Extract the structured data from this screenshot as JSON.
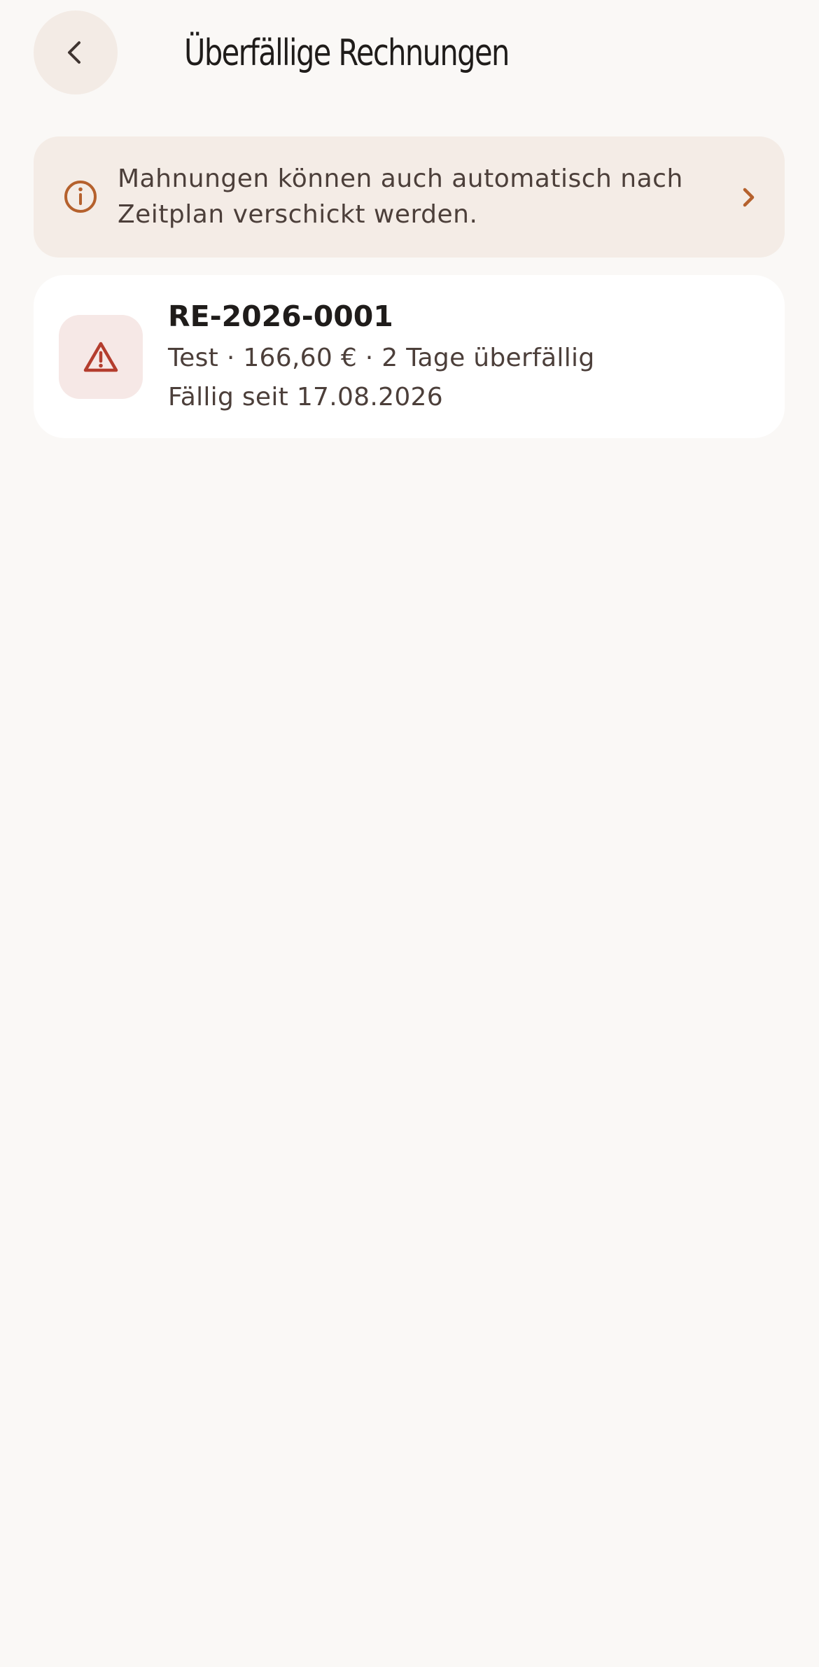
{
  "header": {
    "title": "Überfällige Rechnungen",
    "back_icon": "chevron-left-icon"
  },
  "info_banner": {
    "text_line1": "Mahnungen können auch automatisch nach",
    "text_line2": "Zeitplan verschickt werden.",
    "icon": "info-icon",
    "action_icon": "chevron-right-icon",
    "accent_color": "#b5612d"
  },
  "invoices": [
    {
      "number": "RE-2026-0001",
      "customer": "Test",
      "separator": " · ",
      "amount": "166,60 €",
      "overdue": "2 Tage überfällig",
      "due_label": "Fällig seit 17.08.2026",
      "icon": "warning-icon",
      "status_color": "#b43d2e"
    }
  ]
}
